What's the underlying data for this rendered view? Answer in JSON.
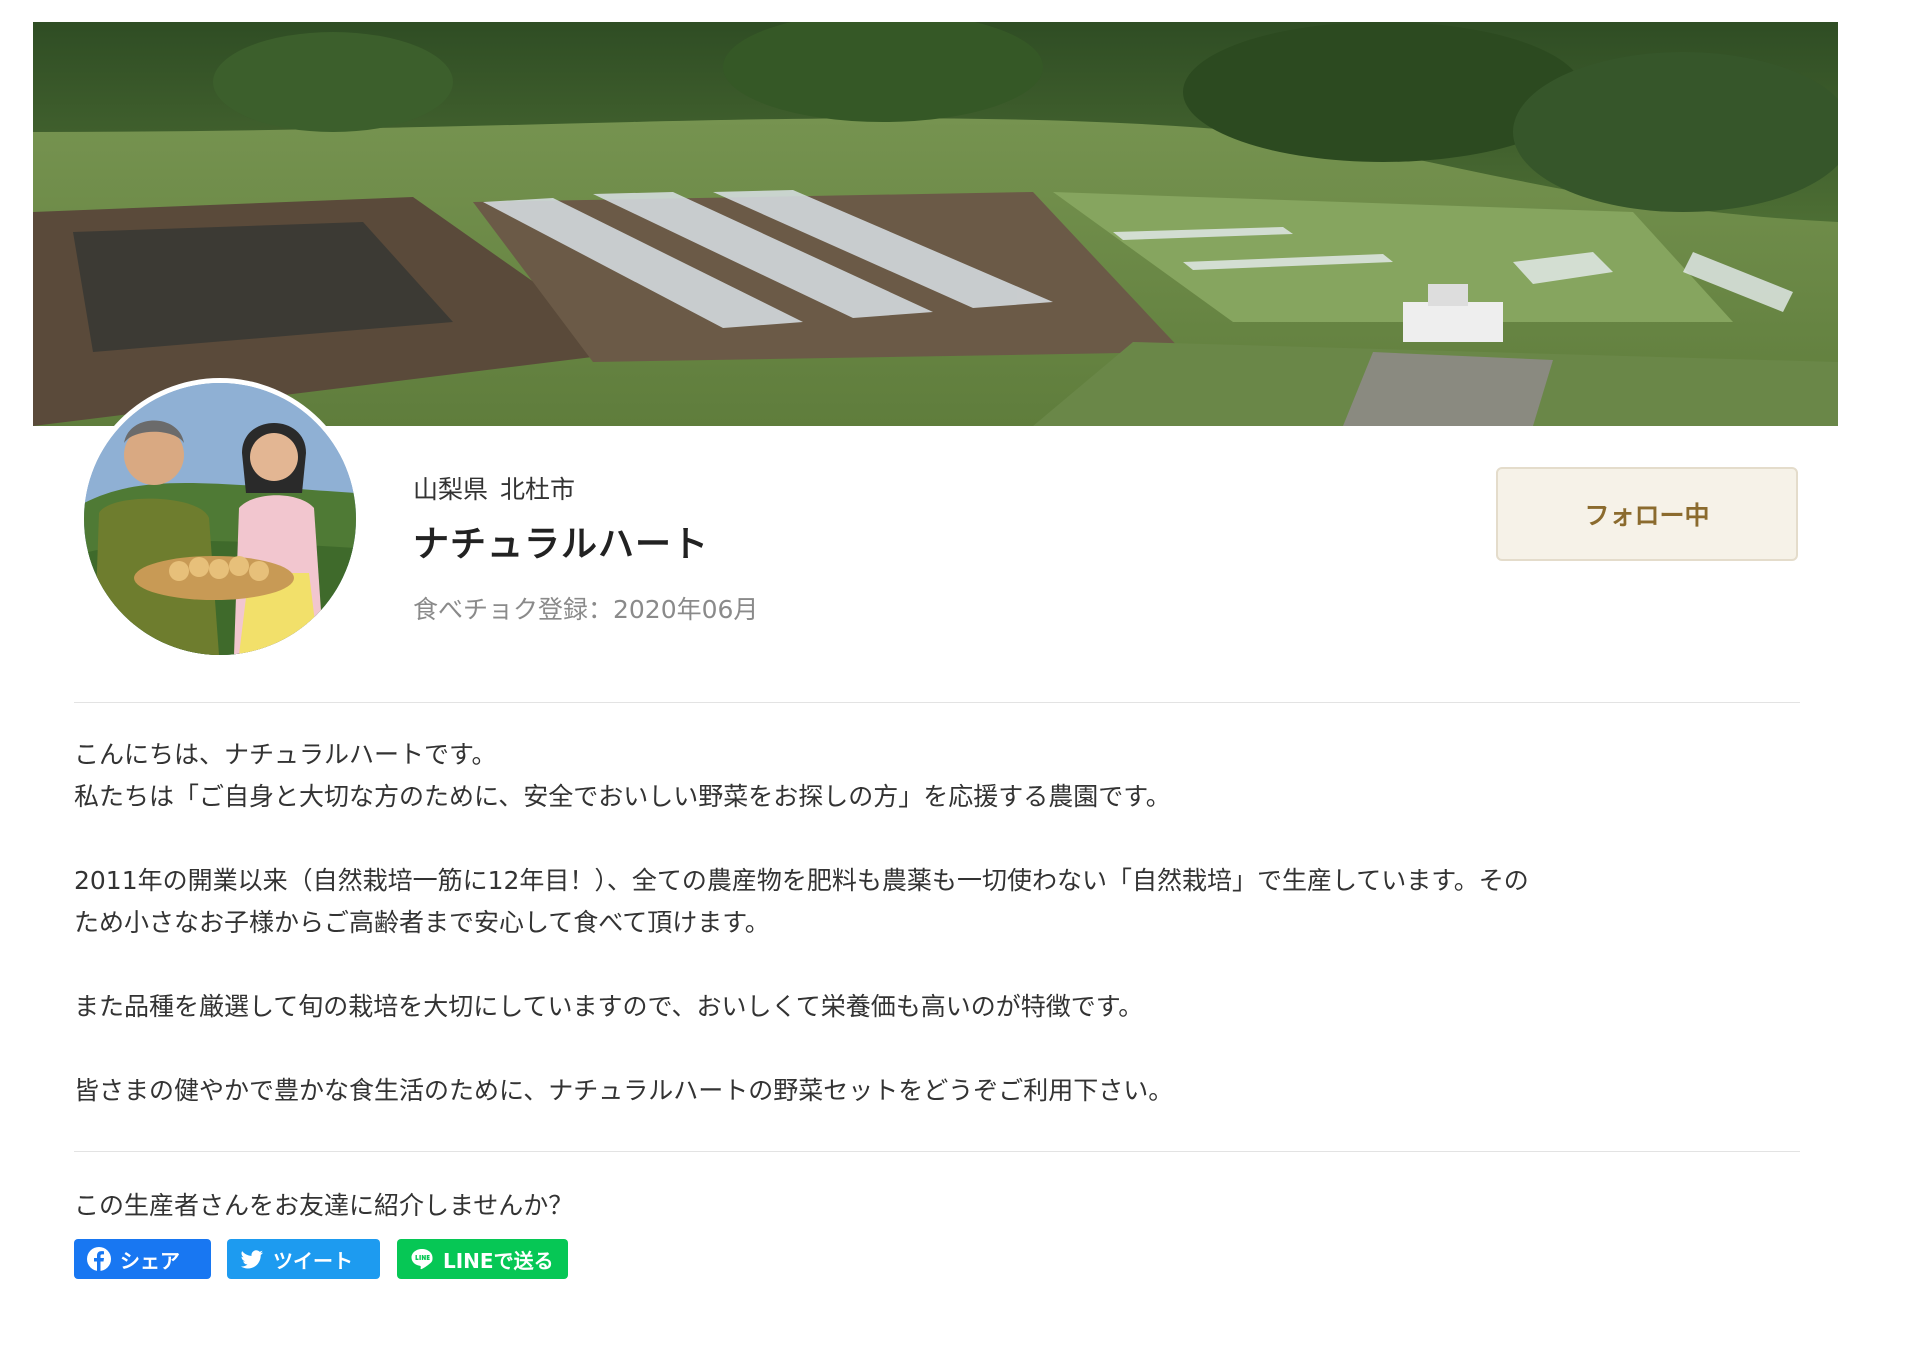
{
  "cover": {
    "alt_subject": "farm-field-landscape"
  },
  "profile": {
    "prefecture": "山梨県",
    "city": "北杜市",
    "name": "ナチュラルハート",
    "registered": "食べチョク登録：2020年06月",
    "follow_label": "フォロー中"
  },
  "intro": {
    "line1": "こんにちは、ナチュラルハートです。",
    "line2": "私たちは「ご自身と大切な方のために、安全でおいしい野菜をお探しの方」を応援する農園です。",
    "line3": "2011年の開業以来（自然栽培一筋に12年目！）、全ての農産物を肥料も農薬も一切使わない「自然栽培」で生産しています。その",
    "line4": "ため小さなお子様からご高齢者まで安心して食べて頂けます。",
    "line5": "また品種を厳選して旬の栽培を大切にしていますので、おいしくて栄養価も高いのが特徴です。",
    "line6": "皆さまの健やかで豊かな食生活のために、ナチュラルハートの野菜セットをどうぞご利用下さい。"
  },
  "share": {
    "title": "この生産者さんをお友達に紹介しませんか？",
    "facebook_label": "シェア",
    "twitter_label": "ツイート",
    "line_label": "LINEで送る"
  },
  "colors": {
    "follow_bg": "#f6f2e8",
    "follow_text": "#8b6b2e",
    "facebook": "#1877f2",
    "twitter": "#1d9bf0",
    "line": "#06c755"
  }
}
